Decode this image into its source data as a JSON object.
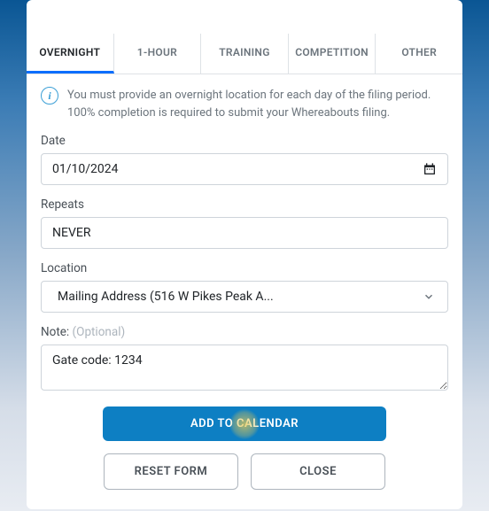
{
  "tabs": {
    "overnight": "OVERNIGHT",
    "one_hour": "1-HOUR",
    "training": "TRAINING",
    "competition": "COMPETITION",
    "other": "OTHER"
  },
  "info_text": "You must provide an overnight location for each day of the filing period. 100% completion is required to submit your Whereabouts filing.",
  "date": {
    "label": "Date",
    "value": "01/10/2024"
  },
  "repeats": {
    "label": "Repeats",
    "value": "NEVER"
  },
  "location": {
    "label": "Location",
    "value": "Mailing Address (516 W Pikes Peak A..."
  },
  "note": {
    "label": "Note: ",
    "optional": "(Optional)",
    "value": "Gate code: 1234"
  },
  "buttons": {
    "add": "ADD TO CALENDAR",
    "reset": "RESET FORM",
    "close": "CLOSE"
  }
}
